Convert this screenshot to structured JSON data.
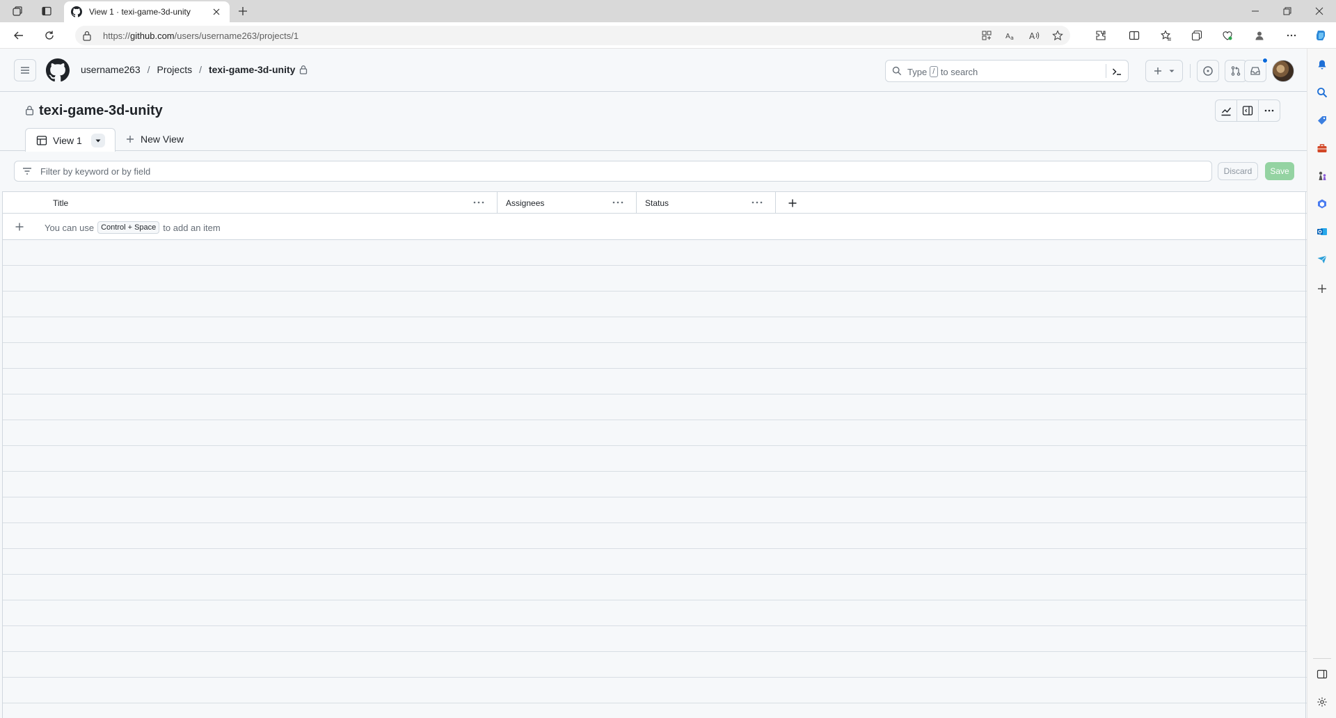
{
  "browser": {
    "tab_title": "View 1 · texi-game-3d-unity",
    "url_prefix": "https://",
    "url_host": "github.com",
    "url_path": "/users/username263/projects/1"
  },
  "header": {
    "breadcrumb": [
      "username263",
      "Projects",
      "texi-game-3d-unity"
    ],
    "search_prefix": "Type",
    "search_key": "/",
    "search_suffix": "to search"
  },
  "project": {
    "title": "texi-game-3d-unity",
    "views": [
      {
        "label": "View 1"
      }
    ],
    "new_view_label": "New View"
  },
  "filter": {
    "placeholder": "Filter by keyword or by field",
    "discard_label": "Discard",
    "save_label": "Save"
  },
  "table": {
    "columns": [
      {
        "label": "Title"
      },
      {
        "label": "Assignees"
      },
      {
        "label": "Status"
      }
    ],
    "add_row": {
      "text_before": "You can use",
      "shortcut": "Control + Space",
      "text_after": "to add an item"
    }
  },
  "colors": {
    "accent_blue": "#0969da",
    "save_green_disabled": "#94d3a2",
    "border": "#d0d7de",
    "page_bg": "#f6f8fa"
  }
}
